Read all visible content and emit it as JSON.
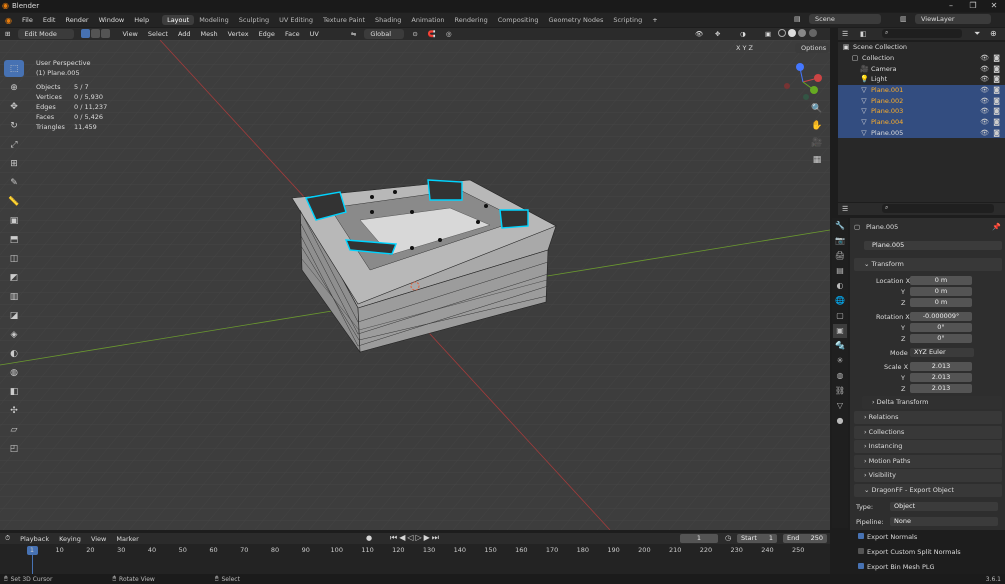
{
  "window": {
    "title": "Blender"
  },
  "menu": [
    "File",
    "Edit",
    "Render",
    "Window",
    "Help"
  ],
  "workspaces": [
    "Layout",
    "Modeling",
    "Sculpting",
    "UV Editing",
    "Texture Paint",
    "Shading",
    "Animation",
    "Rendering",
    "Compositing",
    "Geometry Nodes",
    "Scripting"
  ],
  "scene": {
    "scene_label": "Scene",
    "viewlayer_label": "ViewLayer"
  },
  "header3d": {
    "mode": "Edit Mode",
    "menus": [
      "View",
      "Select",
      "Add",
      "Mesh",
      "Vertex",
      "Edge",
      "Face",
      "UV"
    ],
    "orientation": "Global",
    "options_label": "Options",
    "xyz": "X Y Z"
  },
  "viewport": {
    "view_name": "User Perspective",
    "object_name": "(1) Plane.005",
    "stats": [
      {
        "label": "Objects",
        "value": "5 / 7"
      },
      {
        "label": "Vertices",
        "value": "0 / 5,930"
      },
      {
        "label": "Edges",
        "value": "0 / 11,237"
      },
      {
        "label": "Faces",
        "value": "0 / 5,426"
      },
      {
        "label": "Triangles",
        "value": "11,459"
      }
    ]
  },
  "outliner": {
    "items": [
      {
        "name": "Scene Collection",
        "indent": 0,
        "icon": "▣",
        "selected": false,
        "objsel": false
      },
      {
        "name": "Collection",
        "indent": 1,
        "icon": "▢",
        "selected": false,
        "objsel": false
      },
      {
        "name": "Camera",
        "indent": 2,
        "icon": "🎥",
        "selected": false,
        "objsel": false
      },
      {
        "name": "Light",
        "indent": 2,
        "icon": "💡",
        "selected": false,
        "objsel": false
      },
      {
        "name": "Plane.001",
        "indent": 2,
        "icon": "▽",
        "selected": true,
        "objsel": true
      },
      {
        "name": "Plane.002",
        "indent": 2,
        "icon": "▽",
        "selected": true,
        "objsel": true
      },
      {
        "name": "Plane.003",
        "indent": 2,
        "icon": "▽",
        "selected": true,
        "objsel": true
      },
      {
        "name": "Plane.004",
        "indent": 2,
        "icon": "▽",
        "selected": true,
        "objsel": true
      },
      {
        "name": "Plane.005",
        "indent": 2,
        "icon": "▽",
        "selected": true,
        "objsel": false
      }
    ]
  },
  "properties": {
    "object_name": "Plane.005",
    "object_datablock": "Plane.005",
    "transform_label": "Transform",
    "location": {
      "label": "Location",
      "x": "0 m",
      "y": "0 m",
      "z": "0 m"
    },
    "rotation": {
      "label": "Rotation",
      "x": "-0.000009°",
      "y": "0°",
      "z": "0°"
    },
    "mode": {
      "label": "Mode",
      "value": "XYZ Euler"
    },
    "scale": {
      "label": "Scale",
      "x": "2.013",
      "y": "2.013",
      "z": "2.013"
    },
    "axis": {
      "x": "X",
      "y": "Y",
      "z": "Z"
    },
    "delta_transform": "Delta Transform",
    "panels": [
      "Relations",
      "Collections",
      "Instancing",
      "Motion Paths",
      "Visibility"
    ],
    "export_panel": "DragonFF - Export Object",
    "type": {
      "label": "Type:",
      "value": "Object"
    },
    "pipeline": {
      "label": "Pipeline:",
      "value": "None"
    },
    "checks": [
      "Export Normals",
      "Export Custom Split Normals",
      "Export Bin Mesh PLG"
    ]
  },
  "timeline": {
    "menus": [
      "Playback",
      "Keying",
      "View",
      "Marker"
    ],
    "current_frame": "1",
    "start_label": "Start",
    "start": "1",
    "end_label": "End",
    "end": "250",
    "ticks": [
      "1",
      "10",
      "20",
      "30",
      "40",
      "50",
      "60",
      "70",
      "80",
      "90",
      "100",
      "110",
      "120",
      "130",
      "140",
      "150",
      "160",
      "170",
      "180",
      "190",
      "200",
      "210",
      "220",
      "230",
      "240",
      "250"
    ]
  },
  "status": {
    "hints": [
      "Set 3D Cursor",
      "Rotate View",
      "Select"
    ],
    "version": "3.6.1"
  },
  "colors": {
    "accent": "#4772b3",
    "selected_edge": "#00d4ff",
    "outliner_sel": "#334d80"
  }
}
